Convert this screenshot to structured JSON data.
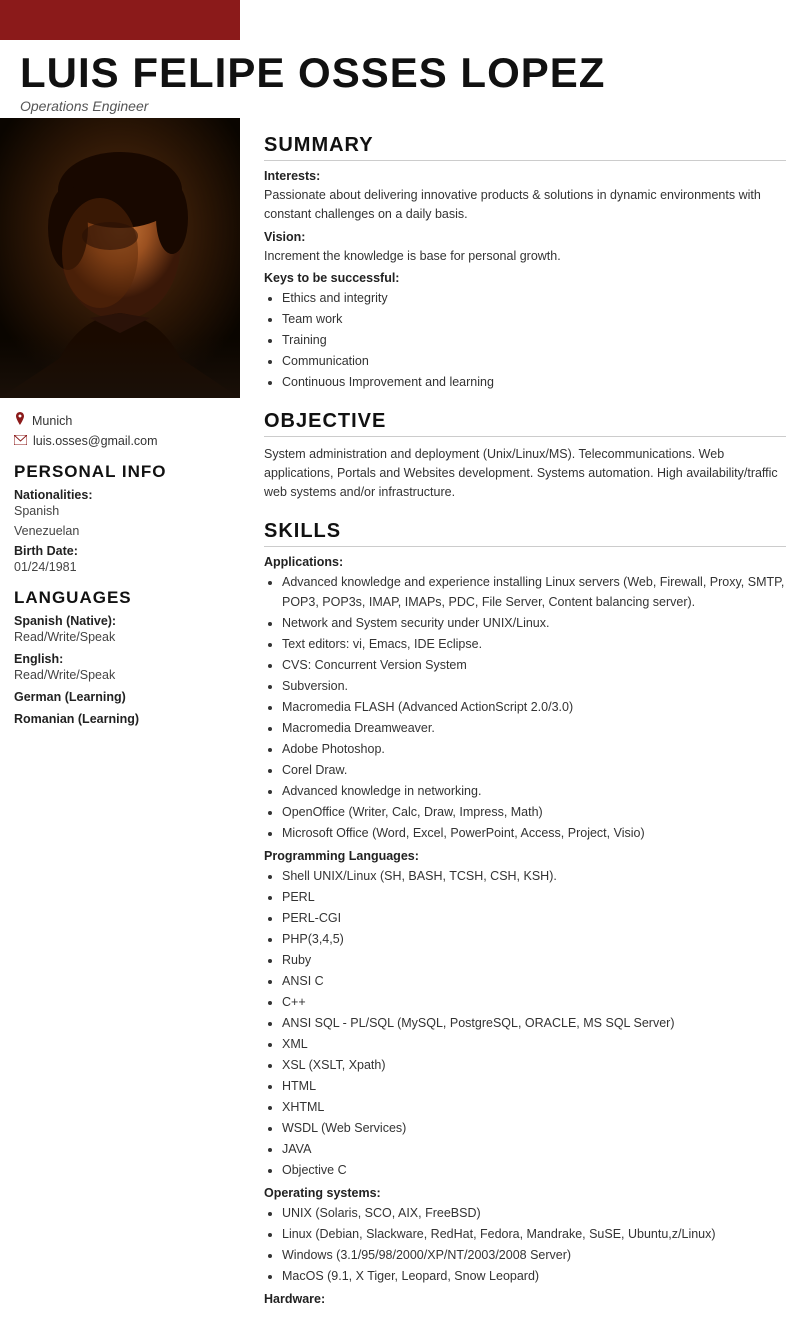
{
  "header": {
    "bar_color": "#8b1a1a",
    "name": "LUIS FELIPE OSSES LOPEZ",
    "job_title": "Operations Engineer"
  },
  "contact": {
    "location": "Munich",
    "email": "luis.osses@gmail.com"
  },
  "personal_info": {
    "section_title": "PERSONAL INFO",
    "nationalities_label": "Nationalities:",
    "nationality_1": "Spanish",
    "nationality_2": "Venezuelan",
    "birth_date_label": "Birth Date:",
    "birth_date": "01/24/1981"
  },
  "languages": {
    "section_title": "LANGUAGES",
    "entries": [
      {
        "label": "Spanish (Native):",
        "value": "Read/Write/Speak"
      },
      {
        "label": "English:",
        "value": "Read/Write/Speak"
      },
      {
        "label": "German (Learning)",
        "value": ""
      },
      {
        "label": "Romanian (Learning)",
        "value": ""
      }
    ]
  },
  "summary": {
    "section_title": "SUMMARY",
    "interests_label": "Interests:",
    "interests_text": "Passionate about delivering innovative products & solutions in dynamic environments with constant challenges on a daily basis.",
    "vision_label": "Vision:",
    "vision_text": "Increment the knowledge is base for personal growth.",
    "keys_label": "Keys to be successful:",
    "keys_list": [
      "Ethics and integrity",
      "Team work",
      "Training",
      "Communication",
      "Continuous Improvement and learning"
    ]
  },
  "objective": {
    "section_title": "OBJECTIVE",
    "text": "System administration and deployment (Unix/Linux/MS). Telecommunications. Web applications, Portals and Websites development. Systems automation. High availability/traffic web systems and/or infrastructure."
  },
  "skills": {
    "section_title": "SKILLS",
    "applications_label": "Applications:",
    "applications_list": [
      "Advanced knowledge and experience installing Linux servers (Web, Firewall, Proxy, SMTP, POP3, POP3s, IMAP, IMAPs, PDC, File Server, Content balancing server).",
      "Network and System security under UNIX/Linux.",
      "Text editors: vi, Emacs, IDE Eclipse.",
      "CVS: Concurrent Version System",
      "Subversion.",
      "Macromedia FLASH (Advanced ActionScript 2.0/3.0)",
      "Macromedia Dreamweaver.",
      "Adobe Photoshop.",
      "Corel Draw.",
      "Advanced knowledge in networking.",
      "OpenOffice (Writer, Calc, Draw, Impress, Math)",
      "Microsoft Office (Word, Excel, PowerPoint, Access, Project, Visio)"
    ],
    "programming_label": "Programming Languages:",
    "programming_list": [
      "Shell UNIX/Linux (SH, BASH, TCSH, CSH, KSH).",
      "PERL",
      "PERL-CGI",
      "PHP(3,4,5)",
      "Ruby",
      "ANSI C",
      "C++",
      "ANSI SQL - PL/SQL (MySQL, PostgreSQL, ORACLE, MS SQL Server)",
      "XML",
      "XSL (XSLT, Xpath)",
      "HTML",
      "XHTML",
      "WSDL (Web Services)",
      "JAVA",
      "Objective C"
    ],
    "os_label": "Operating systems:",
    "os_list": [
      "UNIX (Solaris, SCO, AIX, FreeBSD)",
      "Linux (Debian, Slackware, RedHat, Fedora, Mandrake, SuSE, Ubuntu,z/Linux)",
      "Windows (3.1/95/98/2000/XP/NT/2003/2008 Server)",
      "MacOS (9.1, X Tiger, Leopard, Snow Leopard)"
    ],
    "hardware_label": "Hardware:"
  }
}
